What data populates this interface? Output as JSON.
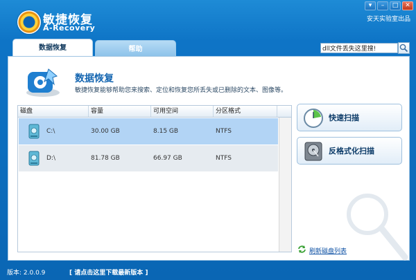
{
  "app": {
    "title_cn": "敏捷恢复",
    "title_en": "A-Recovery",
    "studio": "安天实验室出品",
    "window_buttons": [
      "▾",
      "–",
      "□",
      "✕"
    ]
  },
  "tabs": [
    {
      "label": "数据恢复",
      "active": true
    },
    {
      "label": "帮助",
      "active": false
    }
  ],
  "search": {
    "value": "dll文件丢失这里搜!"
  },
  "hero": {
    "title": "数据恢复",
    "description": "敏捷恢复能够帮助您来搜索、定位和恢复您所丢失或已删除的文本、图像等。"
  },
  "table": {
    "columns": [
      "磁盘",
      "容量",
      "可用空间",
      "分区格式"
    ],
    "rows": [
      {
        "disk": "C:\\",
        "capacity": "30.00 GB",
        "free": "8.15 GB",
        "format": "NTFS",
        "selected": true
      },
      {
        "disk": "D:\\",
        "capacity": "81.78 GB",
        "free": "66.97 GB",
        "format": "NTFS",
        "selected": false
      }
    ]
  },
  "actions": {
    "quick_scan": "快速扫描",
    "unformat_scan": "反格式化扫描",
    "refresh": "刷新磁盘列表"
  },
  "status": {
    "version": "版本: 2.0.0.9",
    "update": "[ 请点击这里下载最新版本 ]"
  },
  "colors": {
    "accent": "#0e74c6",
    "selected_row": "#b2d4f5"
  }
}
